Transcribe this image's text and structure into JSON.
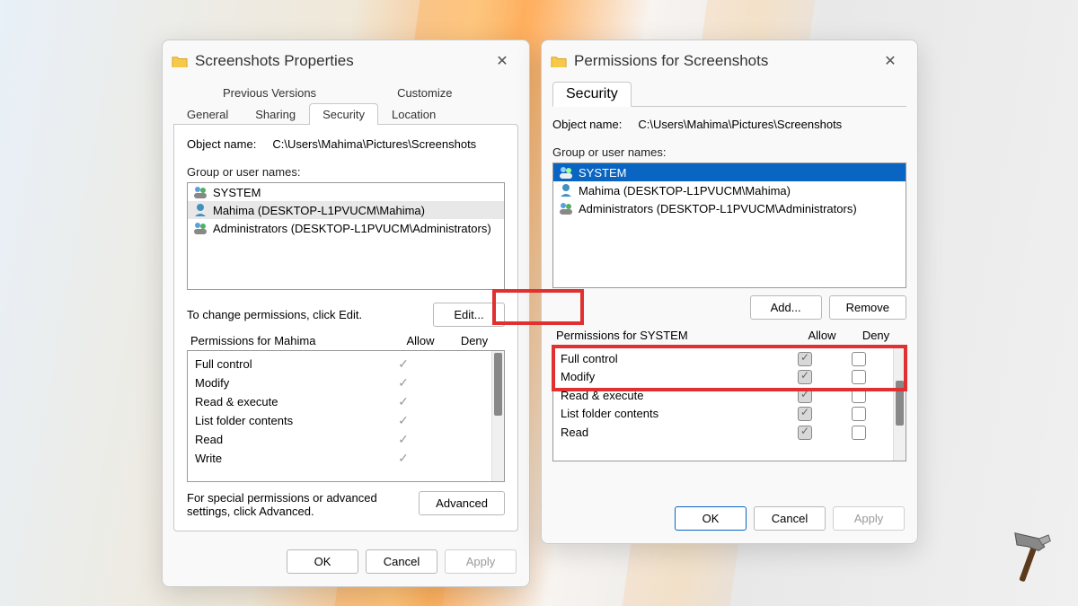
{
  "dialog1": {
    "title": "Screenshots Properties",
    "tabs_row1": [
      "Previous Versions",
      "Customize"
    ],
    "tabs_row2": [
      "General",
      "Sharing",
      "Security",
      "Location"
    ],
    "active_tab": "Security",
    "object_label": "Object name:",
    "object_value": "C:\\Users\\Mahima\\Pictures\\Screenshots",
    "group_label": "Group or user names:",
    "users": [
      {
        "name": "SYSTEM",
        "type": "group"
      },
      {
        "name": "Mahima (DESKTOP-L1PVUCM\\Mahima)",
        "type": "user",
        "selected": "grey"
      },
      {
        "name": "Administrators (DESKTOP-L1PVUCM\\Administrators)",
        "type": "group"
      }
    ],
    "change_hint": "To change permissions, click Edit.",
    "edit_button": "Edit...",
    "perm_for_label": "Permissions for Mahima",
    "allow_label": "Allow",
    "deny_label": "Deny",
    "permissions": [
      {
        "name": "Full control",
        "allow": true,
        "deny": false
      },
      {
        "name": "Modify",
        "allow": true,
        "deny": false
      },
      {
        "name": "Read & execute",
        "allow": true,
        "deny": false
      },
      {
        "name": "List folder contents",
        "allow": true,
        "deny": false
      },
      {
        "name": "Read",
        "allow": true,
        "deny": false
      },
      {
        "name": "Write",
        "allow": true,
        "deny": false
      }
    ],
    "advanced_hint": "For special permissions or advanced settings, click Advanced.",
    "advanced_button": "Advanced",
    "ok": "OK",
    "cancel": "Cancel",
    "apply": "Apply"
  },
  "dialog2": {
    "title": "Permissions for Screenshots",
    "tab": "Security",
    "object_label": "Object name:",
    "object_value": "C:\\Users\\Mahima\\Pictures\\Screenshots",
    "group_label": "Group or user names:",
    "users": [
      {
        "name": "SYSTEM",
        "type": "group",
        "selected": "blue"
      },
      {
        "name": "Mahima (DESKTOP-L1PVUCM\\Mahima)",
        "type": "user"
      },
      {
        "name": "Administrators (DESKTOP-L1PVUCM\\Administrators)",
        "type": "group"
      }
    ],
    "add_button": "Add...",
    "remove_button": "Remove",
    "perm_for_label": "Permissions for SYSTEM",
    "allow_label": "Allow",
    "deny_label": "Deny",
    "permissions": [
      {
        "name": "Full control",
        "allow": true,
        "deny": false
      },
      {
        "name": "Modify",
        "allow": true,
        "deny": false
      },
      {
        "name": "Read & execute",
        "allow": true,
        "deny": false
      },
      {
        "name": "List folder contents",
        "allow": true,
        "deny": false
      },
      {
        "name": "Read",
        "allow": true,
        "deny": false
      }
    ],
    "ok": "OK",
    "cancel": "Cancel",
    "apply": "Apply"
  }
}
